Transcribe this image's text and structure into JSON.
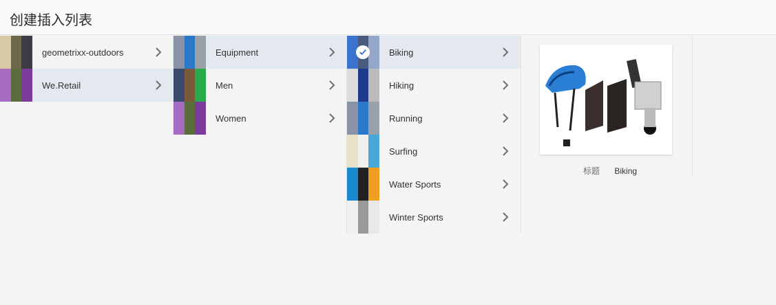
{
  "header": {
    "title": "创建插入列表"
  },
  "columns": [
    {
      "items": [
        {
          "label": "geometrixx-outdoors",
          "active": false,
          "thumb": [
            "#d8c9a4",
            "#6c6a4a",
            "#3c3c46"
          ]
        },
        {
          "label": "We.Retail",
          "active": true,
          "thumb": [
            "#a56cc2",
            "#5a6d3c",
            "#7b3c9c"
          ]
        }
      ]
    },
    {
      "items": [
        {
          "label": "Equipment",
          "active": true,
          "thumb": [
            "#8a93a5",
            "#2a78c8",
            "#9aa0a8"
          ]
        },
        {
          "label": "Men",
          "active": false,
          "thumb": [
            "#3b4a6a",
            "#7b5a3c",
            "#2aaa4a"
          ]
        },
        {
          "label": "Women",
          "active": false,
          "thumb": [
            "#a56cc2",
            "#5a6d3c",
            "#7b3c9c"
          ]
        }
      ]
    },
    {
      "items": [
        {
          "label": "Biking",
          "active": true,
          "selected": true,
          "thumb": [
            "#2a6fd0",
            "#444",
            "#ccc"
          ]
        },
        {
          "label": "Hiking",
          "active": false,
          "thumb": [
            "#ddd",
            "#1e3a8a",
            "#bbb"
          ]
        },
        {
          "label": "Running",
          "active": false,
          "thumb": [
            "#8a93a5",
            "#2a78c8",
            "#9aa0a8"
          ]
        },
        {
          "label": "Surfing",
          "active": false,
          "thumb": [
            "#e8e0c8",
            "#f0f0f0",
            "#4aa8d8"
          ]
        },
        {
          "label": "Water Sports",
          "active": false,
          "thumb": [
            "#1a8ad0",
            "#222",
            "#f0a020"
          ]
        },
        {
          "label": "Winter Sports",
          "active": false,
          "thumb": [
            "#f0f0f0",
            "#999",
            "#e8e8e8"
          ]
        }
      ]
    }
  ],
  "preview": {
    "meta_key": "标题",
    "meta_value": "Biking"
  },
  "colors": {
    "active_row": "#e4e9f0",
    "chevron": "#6e6e6e"
  }
}
